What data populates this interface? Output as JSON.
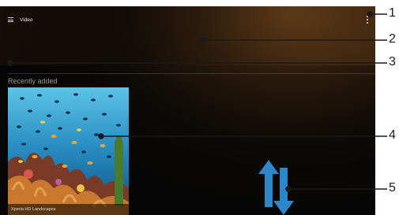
{
  "app": {
    "title": "Video"
  },
  "section": {
    "recently_added_label": "Recently added"
  },
  "videos": [
    {
      "title": "Xperia HD Landscapes"
    }
  ],
  "callouts": [
    "1",
    "2",
    "3",
    "4",
    "5"
  ],
  "icons": {
    "menu": "hamburger-menu-icon",
    "more": "overflow-menu-icon",
    "scroll": "scroll-up-down-arrows-icon"
  },
  "colors": {
    "arrow_blue": "#2d86c7",
    "callout_line": "#1a1a1a"
  }
}
